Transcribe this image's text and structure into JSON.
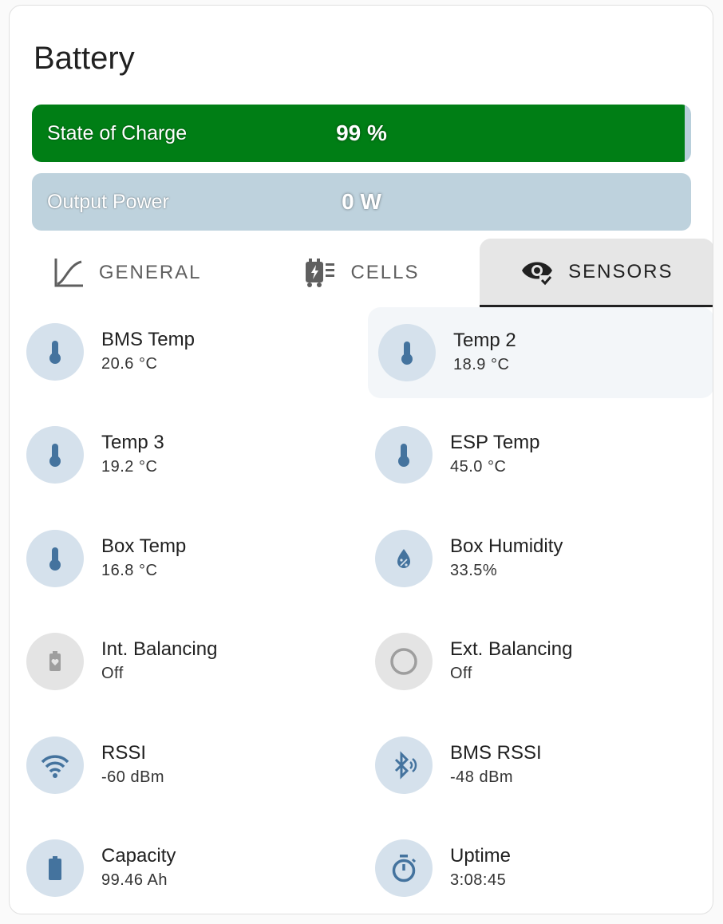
{
  "card": {
    "title": "Battery"
  },
  "bars": {
    "soc": {
      "label": "State of Charge",
      "value": "99 %",
      "fraction": 0.99,
      "fill_color": "#007e15",
      "track_color": "#b8cfdb"
    },
    "power": {
      "label": "Output Power",
      "value": "0 W",
      "fraction": 0.0,
      "fill_color": "#007e15",
      "track_color": "#bed2dd"
    }
  },
  "tabs": [
    {
      "label": "GENERAL",
      "icon": "chart-line-icon",
      "active": false
    },
    {
      "label": "CELLS",
      "icon": "battery-cells-icon",
      "active": false
    },
    {
      "label": "SENSORS",
      "icon": "eye-check-icon",
      "active": true
    }
  ],
  "sensors": [
    {
      "name": "BMS Temp",
      "state": "20.6 °C",
      "icon": "thermometer-icon"
    },
    {
      "name": "Temp 2",
      "state": "18.9 °C",
      "icon": "thermometer-icon"
    },
    {
      "name": "Temp 3",
      "state": "19.2 °C",
      "icon": "thermometer-icon"
    },
    {
      "name": "ESP Temp",
      "state": "45.0 °C",
      "icon": "thermometer-icon"
    },
    {
      "name": "Box Temp",
      "state": "16.8 °C",
      "icon": "thermometer-icon"
    },
    {
      "name": "Box Humidity",
      "state": "33.5%",
      "icon": "water-percent-icon"
    },
    {
      "name": "Int. Balancing",
      "state": "Off",
      "icon": "battery-heart-icon"
    },
    {
      "name": "Ext. Balancing",
      "state": "Off",
      "icon": "circle-outline-icon"
    },
    {
      "name": "RSSI",
      "state": "-60 dBm",
      "icon": "wifi-icon"
    },
    {
      "name": "BMS RSSI",
      "state": "-48 dBm",
      "icon": "bluetooth-audio-icon"
    },
    {
      "name": "Capacity",
      "state": "99.46 Ah",
      "icon": "battery-icon"
    },
    {
      "name": "Uptime",
      "state": "3:08:45",
      "icon": "timer-icon"
    }
  ],
  "colors": {
    "accent_icon": "#44739e",
    "icon_bg": "#d5e1ec",
    "off_icon": "#9e9e9e",
    "off_bg": "#e4e4e4"
  }
}
